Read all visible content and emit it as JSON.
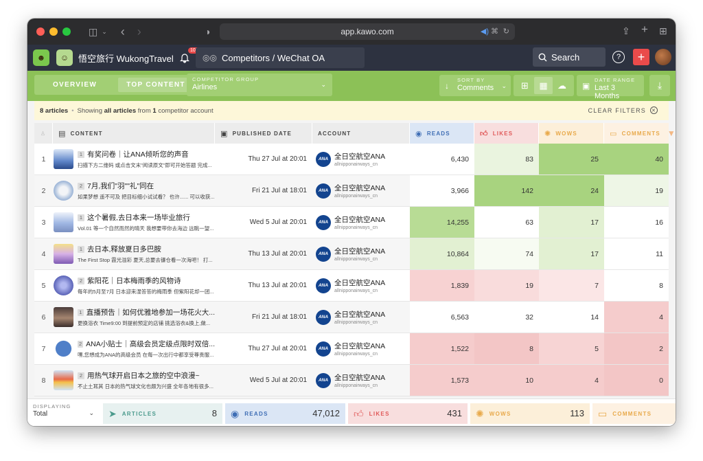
{
  "browser": {
    "url": "app.kawo.com"
  },
  "header": {
    "brand_name": "悟空旅行 WukongTravel",
    "notification_count": "100",
    "competitor_selector": "Competitors / WeChat OA",
    "search_label": "Search",
    "help_glyph": "?",
    "add_glyph": "+"
  },
  "toolbar": {
    "tabs": [
      {
        "label": "OVERVIEW",
        "active": false
      },
      {
        "label": "TOP CONTENT",
        "active": true
      }
    ],
    "competitor_group": {
      "label": "COMPETITOR GROUP",
      "value": "Airlines"
    },
    "sort_by": {
      "label": "SORT BY",
      "value": "Comments"
    },
    "date_range": {
      "label": "DATE RANGE",
      "value": "Last 3 Months"
    }
  },
  "filter_bar": {
    "count": "8 articles",
    "sep": "•",
    "showing": "Showing",
    "all_articles": "all articles",
    "from": "from",
    "account_count": "1",
    "tail": "competitor account",
    "clear_filters": "CLEAR FILTERS"
  },
  "table": {
    "headers": {
      "content": "CONTENT",
      "published": "PUBLISHED DATE",
      "account": "ACCOUNT",
      "reads": "READS",
      "likes": "LIKES",
      "wows": "WOWS",
      "comments": "COMMENTS"
    },
    "rows": [
      {
        "index": "1",
        "pos": "1",
        "title": "有奖问卷｜让ANA倾听您的声音",
        "subtitle": "扫描下方二维码 或点击文末\"阅读原文\"即可开始答题 完成...",
        "date": "Thu 27 Jul at 20:01",
        "account": "全日空航空ANA",
        "handle": "allnipponairways_cn",
        "reads": "6,430",
        "likes": "83",
        "wows": "25",
        "comments": "40"
      },
      {
        "index": "2",
        "pos": "2",
        "title": "7月,我们\"羽\"\"礼\"同在",
        "subtitle": "如果梦想 遥不可及 把目标细小试试看？ 也许...... 可以收获...",
        "date": "Fri 21 Jul at 18:01",
        "account": "全日空航空ANA",
        "handle": "allnipponairways_cn",
        "reads": "3,966",
        "likes": "142",
        "wows": "24",
        "comments": "19"
      },
      {
        "index": "3",
        "pos": "1",
        "title": "这个暑假,去日本来一场毕业旅行",
        "subtitle": "Vol.01 等一个自然而然的晴天 我想要带你去海边 远眺一望...",
        "date": "Wed 5 Jul at 20:01",
        "account": "全日空航空ANA",
        "handle": "allnipponairways_cn",
        "reads": "14,255",
        "likes": "63",
        "wows": "17",
        "comments": "16"
      },
      {
        "index": "4",
        "pos": "1",
        "title": "去日本,释放夏日多巴胺",
        "subtitle": "The First Stop 霞光溢彩 夏天,总要去镰仓看一次海吧！ 打...",
        "date": "Thu 13 Jul at 20:01",
        "account": "全日空航空ANA",
        "handle": "allnipponairways_cn",
        "reads": "10,864",
        "likes": "74",
        "wows": "17",
        "comments": "11"
      },
      {
        "index": "5",
        "pos": "2",
        "title": "紫阳花｜日本梅雨季的风物诗",
        "subtitle": "每年的5月至7月 日本迎来湿答答的梅雨季 但紫阳花却一团...",
        "date": "Thu 13 Jul at 20:01",
        "account": "全日空航空ANA",
        "handle": "allnipponairways_cn",
        "reads": "1,839",
        "likes": "19",
        "wows": "7",
        "comments": "8"
      },
      {
        "index": "6",
        "pos": "1",
        "title": "直播预告｜如何优雅地参加一场花火大...",
        "subtitle": "更换浴衣 Time9:00 到提前预定的店铺 挑选浴衣&换上,做...",
        "date": "Fri 21 Jul at 18:01",
        "account": "全日空航空ANA",
        "handle": "allnipponairways_cn",
        "reads": "6,563",
        "likes": "32",
        "wows": "14",
        "comments": "4"
      },
      {
        "index": "7",
        "pos": "2",
        "title": "ANA小贴士｜高级会员定级点限时双倍...",
        "subtitle": "嘿,您想成为ANA的高级会员 在每一次出行中都享受尊贵服...",
        "date": "Thu 27 Jul at 20:01",
        "account": "全日空航空ANA",
        "handle": "allnipponairways_cn",
        "reads": "1,522",
        "likes": "8",
        "wows": "5",
        "comments": "2"
      },
      {
        "index": "8",
        "pos": "2",
        "title": "用热气球开启日本之旅的空中浪漫~",
        "subtitle": "不止土耳其 日本的热气球文化也颇为兴盛 全年各地有很多...",
        "date": "Wed 5 Jul at 20:01",
        "account": "全日空航空ANA",
        "handle": "allnipponairways_cn",
        "reads": "1,573",
        "likes": "10",
        "wows": "4",
        "comments": "0"
      }
    ]
  },
  "heat": {
    "reads": [
      "#ffffff",
      "#ffffff",
      "#b8dc95",
      "#e2f0d2",
      "#f7d2d2",
      "#ffffff",
      "#f5cccc",
      "#f5cccc"
    ],
    "likes": [
      "#eaf4df",
      "#a8d37f",
      "#ffffff",
      "#f7fbf2",
      "#f9dcdc",
      "#ffffff",
      "#f3c6c6",
      "#f5cccc"
    ],
    "wows": [
      "#a8d37f",
      "#a8d37f",
      "#e2f0d2",
      "#e2f0d2",
      "#fbe6e6",
      "#ffffff",
      "#f7d4d4",
      "#f5cccc"
    ],
    "comments": [
      "#a8d37f",
      "#eef6e6",
      "#ffffff",
      "#ffffff",
      "#ffffff",
      "#f5cccc",
      "#f3c6c6",
      "#f3c6c6"
    ]
  },
  "footer": {
    "displaying": {
      "label": "DISPLAYING",
      "value": "Total"
    },
    "articles": {
      "label": "ARTICLES",
      "value": "8"
    },
    "reads": {
      "label": "READS",
      "value": "47,012"
    },
    "likes": {
      "label": "LIKES",
      "value": "431"
    },
    "wows": {
      "label": "WOWS",
      "value": "113"
    },
    "comments": {
      "label": "COMMENTS",
      "value": ""
    }
  },
  "colors": {
    "green": "#8cc157",
    "header_bg": "#2d3240",
    "reads_blue": "#3f6eb5",
    "likes_red": "#e05a5a",
    "wows_orange": "#e8a94a",
    "comments_orange": "#e8a94a"
  },
  "icons": {
    "sort": "arrow-down-icon",
    "calendar": "calendar-icon",
    "download": "download-icon"
  }
}
